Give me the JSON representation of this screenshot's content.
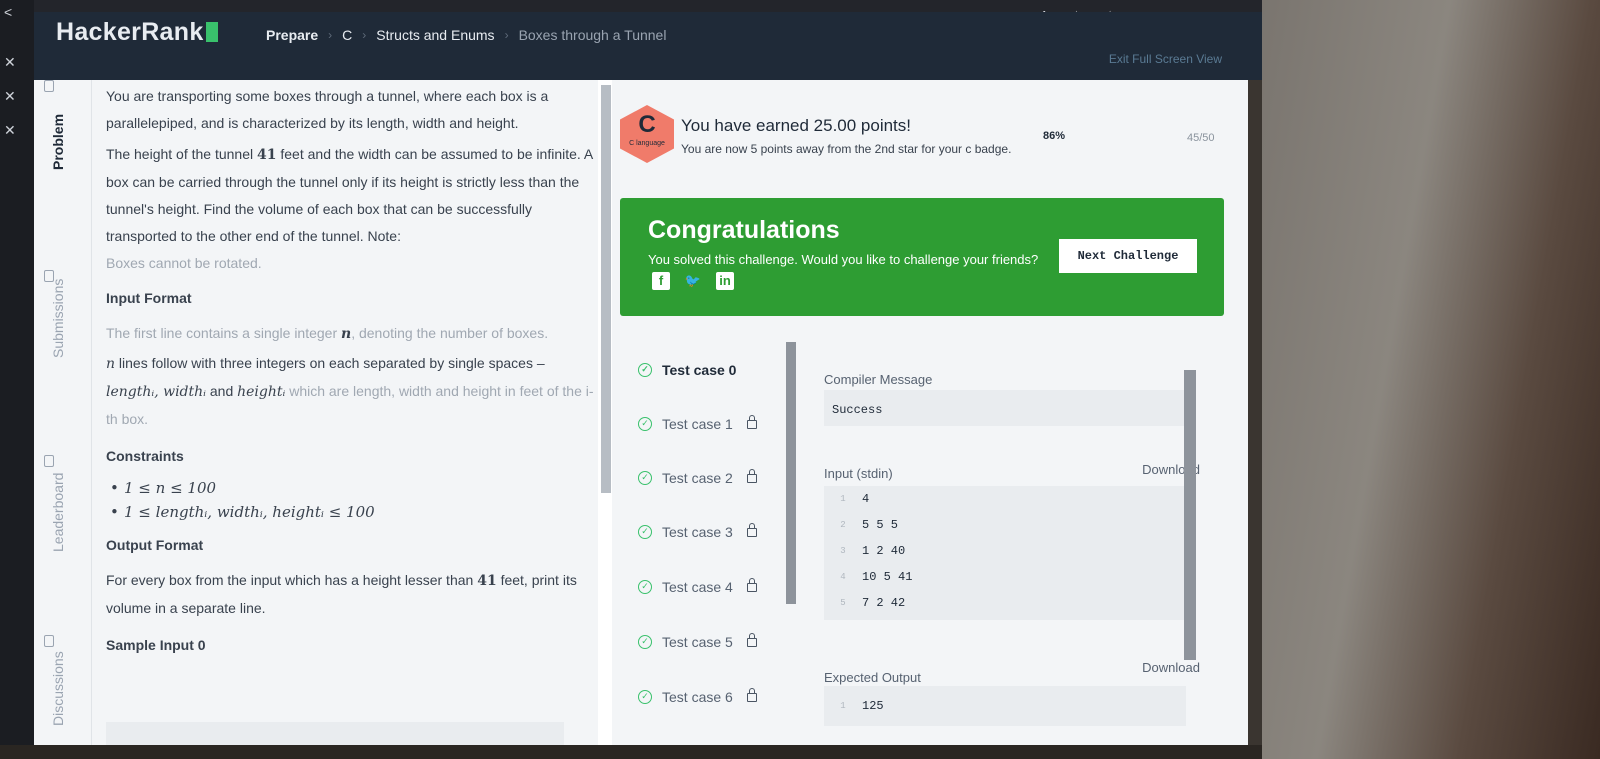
{
  "breadcrumb": {
    "logo": "HackerRank",
    "items": [
      "Prepare",
      "C",
      "Structs and Enums",
      "Boxes through a Tunnel"
    ],
    "exit_fullscreen": "Exit Full Screen View"
  },
  "side_tabs": [
    "Problem",
    "Submissions",
    "Leaderboard",
    "Discussions"
  ],
  "problem": {
    "intro_1": "You are transporting some boxes through a tunnel, where each box is a parallelepiped, and is characterized by its length, width and height.",
    "intro_2a": "The height of the tunnel ",
    "tunnel_height": "41",
    "intro_2b": " feet and the width can be assumed to be infinite. A box can be carried through the tunnel only if its height is strictly less than the tunnel's height. Find the volume of each box that can be successfully transported to the other end of the tunnel. Note:",
    "intro_3": "Boxes cannot be rotated.",
    "input_heading": "Input Format",
    "input_1a": "The first line contains a single integer ",
    "n": "n",
    "input_1b": ", denoting the number of boxes.",
    "input_2a": "n",
    "input_2b": " lines follow with three integers on each separated by single spaces – ",
    "input_2c": "lengthᵢ, widthᵢ",
    "input_2d": " and ",
    "input_2e": "heightᵢ",
    "input_2f": " which are length, width and height in feet of the i-th box.",
    "constraints_heading": "Constraints",
    "constraints": [
      "1 ≤ n ≤ 100",
      "1 ≤ lengthᵢ, widthᵢ, heightᵢ ≤ 100"
    ],
    "output_heading": "Output Format",
    "output_1a": "For every box from the input which has a height lesser than ",
    "output_1b": "41",
    "output_1c": " feet, print its volume in a separate line.",
    "sample_heading": "Sample Input 0"
  },
  "badge": {
    "letter": "C",
    "lang": "C language",
    "earned": "You have earned 25.00 points!",
    "away": "You are now 5 points away from the 2nd star for your c badge.",
    "percent": "86%",
    "count": "45/50"
  },
  "congrats": {
    "title": "Congratulations",
    "message": "You solved this challenge. Would you like to challenge your friends?",
    "next_button": "Next Challenge"
  },
  "tests": [
    "Test case 0",
    "Test case 1",
    "Test case 2",
    "Test case 3",
    "Test case 4",
    "Test case 5",
    "Test case 6"
  ],
  "output": {
    "compiler_label": "Compiler Message",
    "compiler_value": "Success",
    "input_label": "Input (stdin)",
    "download": "Download",
    "input_lines": [
      {
        "n": "1",
        "text": "4"
      },
      {
        "n": "2",
        "text": "5 5 5"
      },
      {
        "n": "3",
        "text": "1 2 40"
      },
      {
        "n": "4",
        "text": "10 5 41"
      },
      {
        "n": "5",
        "text": "7 2 42"
      }
    ],
    "expected_label": "Expected Output",
    "expected_lines": [
      {
        "n": "1",
        "text": "125"
      }
    ]
  }
}
